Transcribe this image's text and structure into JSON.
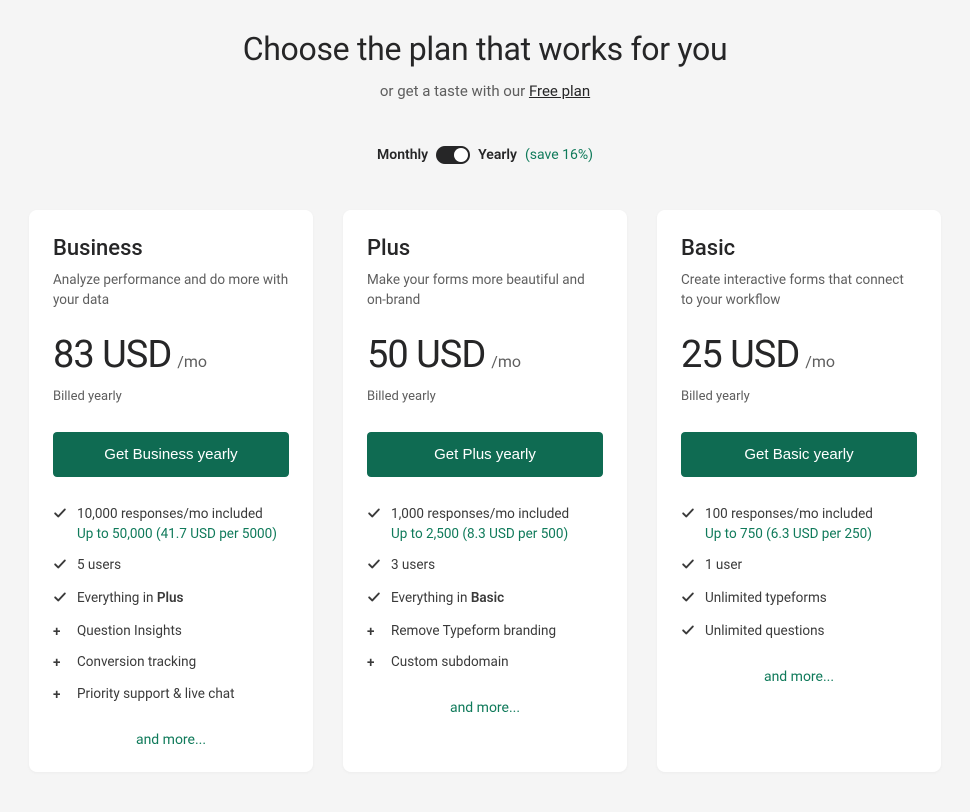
{
  "header": {
    "title": "Choose the plan that works for you",
    "sub_prefix": "or get a taste with our ",
    "sub_link": "Free plan"
  },
  "toggle": {
    "monthly": "Monthly",
    "yearly": "Yearly",
    "save": "(save 16%)"
  },
  "plans": [
    {
      "name": "Business",
      "desc": "Analyze performance and do more with your data",
      "price": "83 USD",
      "per": "/mo",
      "billed": "Billed yearly",
      "cta": "Get Business yearly",
      "features": [
        {
          "icon": "check",
          "text": "10,000 responses/mo included",
          "sub": "Up to 50,000 (41.7 USD per 5000)"
        },
        {
          "icon": "check",
          "text": "5 users"
        },
        {
          "icon": "check",
          "text_pre": "Everything in ",
          "text_bold": "Plus"
        },
        {
          "icon": "plus",
          "text": "Question Insights"
        },
        {
          "icon": "plus",
          "text": "Conversion tracking"
        },
        {
          "icon": "plus",
          "text": "Priority support & live chat"
        }
      ],
      "more": "and more..."
    },
    {
      "name": "Plus",
      "desc": "Make your forms more beautiful and on-brand",
      "price": "50 USD",
      "per": "/mo",
      "billed": "Billed yearly",
      "cta": "Get Plus yearly",
      "features": [
        {
          "icon": "check",
          "text": "1,000 responses/mo included",
          "sub": "Up to 2,500 (8.3 USD per 500)"
        },
        {
          "icon": "check",
          "text": "3 users"
        },
        {
          "icon": "check",
          "text_pre": "Everything in ",
          "text_bold": "Basic"
        },
        {
          "icon": "plus",
          "text": "Remove Typeform branding"
        },
        {
          "icon": "plus",
          "text": "Custom subdomain"
        }
      ],
      "more": "and more..."
    },
    {
      "name": "Basic",
      "desc": "Create interactive forms that connect to your workflow",
      "price": "25 USD",
      "per": "/mo",
      "billed": "Billed yearly",
      "cta": "Get Basic yearly",
      "features": [
        {
          "icon": "check",
          "text": "100 responses/mo included",
          "sub": "Up to 750 (6.3 USD per 250)"
        },
        {
          "icon": "check",
          "text": "1 user"
        },
        {
          "icon": "check",
          "text": "Unlimited typeforms"
        },
        {
          "icon": "check",
          "text": "Unlimited questions"
        }
      ],
      "more": "and more..."
    }
  ]
}
